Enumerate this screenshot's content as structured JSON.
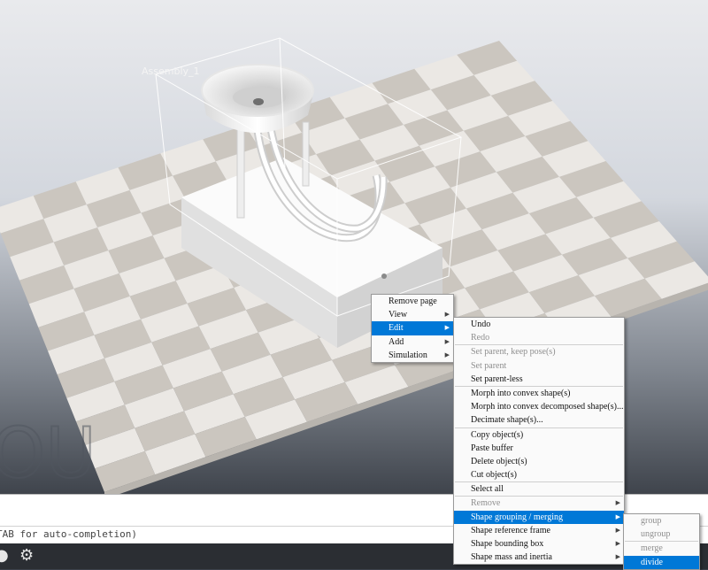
{
  "scene": {
    "assembly_label": "Assembly_1",
    "watermark": "OU"
  },
  "console": {
    "hint": "TAB for auto-completion)"
  },
  "statusbar": {
    "icons": [
      "record-icon",
      "gear-icon"
    ]
  },
  "context_menu": {
    "items": [
      {
        "label": "Remove page",
        "submenu": false,
        "highlighted": false
      },
      {
        "label": "View",
        "submenu": true,
        "highlighted": false
      },
      {
        "label": "Edit",
        "submenu": true,
        "highlighted": true
      },
      {
        "label": "Add",
        "submenu": true,
        "highlighted": false
      },
      {
        "label": "Simulation",
        "submenu": true,
        "highlighted": false
      }
    ]
  },
  "edit_menu": {
    "groups": [
      [
        {
          "label": "Undo",
          "enabled": true
        },
        {
          "label": "Redo",
          "enabled": false
        }
      ],
      [
        {
          "label": "Set parent, keep pose(s)",
          "enabled": false
        },
        {
          "label": "Set parent",
          "enabled": false
        },
        {
          "label": "Set parent-less",
          "enabled": true
        }
      ],
      [
        {
          "label": "Morph into convex shape(s)",
          "enabled": true
        },
        {
          "label": "Morph into convex decomposed shape(s)...",
          "enabled": true
        },
        {
          "label": "Decimate shape(s)...",
          "enabled": true
        }
      ],
      [
        {
          "label": "Copy object(s)",
          "enabled": true
        },
        {
          "label": "Paste buffer",
          "enabled": true
        },
        {
          "label": "Delete object(s)",
          "enabled": true
        },
        {
          "label": "Cut object(s)",
          "enabled": true
        }
      ],
      [
        {
          "label": "Select all",
          "enabled": true
        }
      ],
      [
        {
          "label": "Remove",
          "enabled": false,
          "submenu": true
        },
        {
          "label": "Shape grouping / merging",
          "enabled": true,
          "submenu": true,
          "highlighted": true
        },
        {
          "label": "Shape reference frame",
          "enabled": true,
          "submenu": true
        },
        {
          "label": "Shape bounding box",
          "enabled": true,
          "submenu": true
        },
        {
          "label": "Shape mass and inertia",
          "enabled": true,
          "submenu": true
        }
      ]
    ]
  },
  "grouping_menu": {
    "groups": [
      [
        {
          "label": "group",
          "enabled": false
        },
        {
          "label": "ungroup",
          "enabled": false
        }
      ],
      [
        {
          "label": "merge",
          "enabled": false
        },
        {
          "label": "divide",
          "enabled": true,
          "highlighted": true
        }
      ]
    ]
  },
  "colors": {
    "menu_highlight": "#0078d7",
    "checker_light": "#ebe8e4",
    "checker_dark": "#cbc6bf",
    "disabled_text": "#8e8e8e"
  }
}
